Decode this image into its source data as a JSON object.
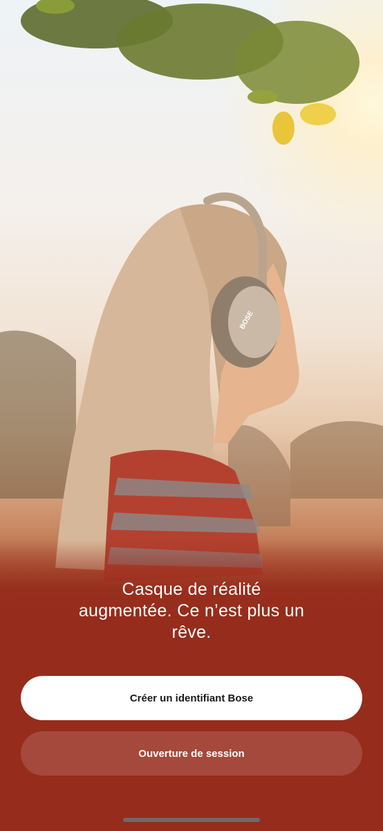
{
  "hero": {
    "image_description_icon": "woman-with-headphones-photo",
    "brand_on_headphones": "BOSE"
  },
  "onboarding": {
    "tagline": "Casque de réalité\naugmentée. Ce n’est plus un\nrêve."
  },
  "actions": {
    "create_id_label": "Créer un identifiant Bose",
    "sign_in_label": "Ouverture de session"
  },
  "colors": {
    "background": "#962c1c",
    "primary_button": "#ffffff",
    "secondary_button": "rgba(255,255,255,0.14)"
  }
}
